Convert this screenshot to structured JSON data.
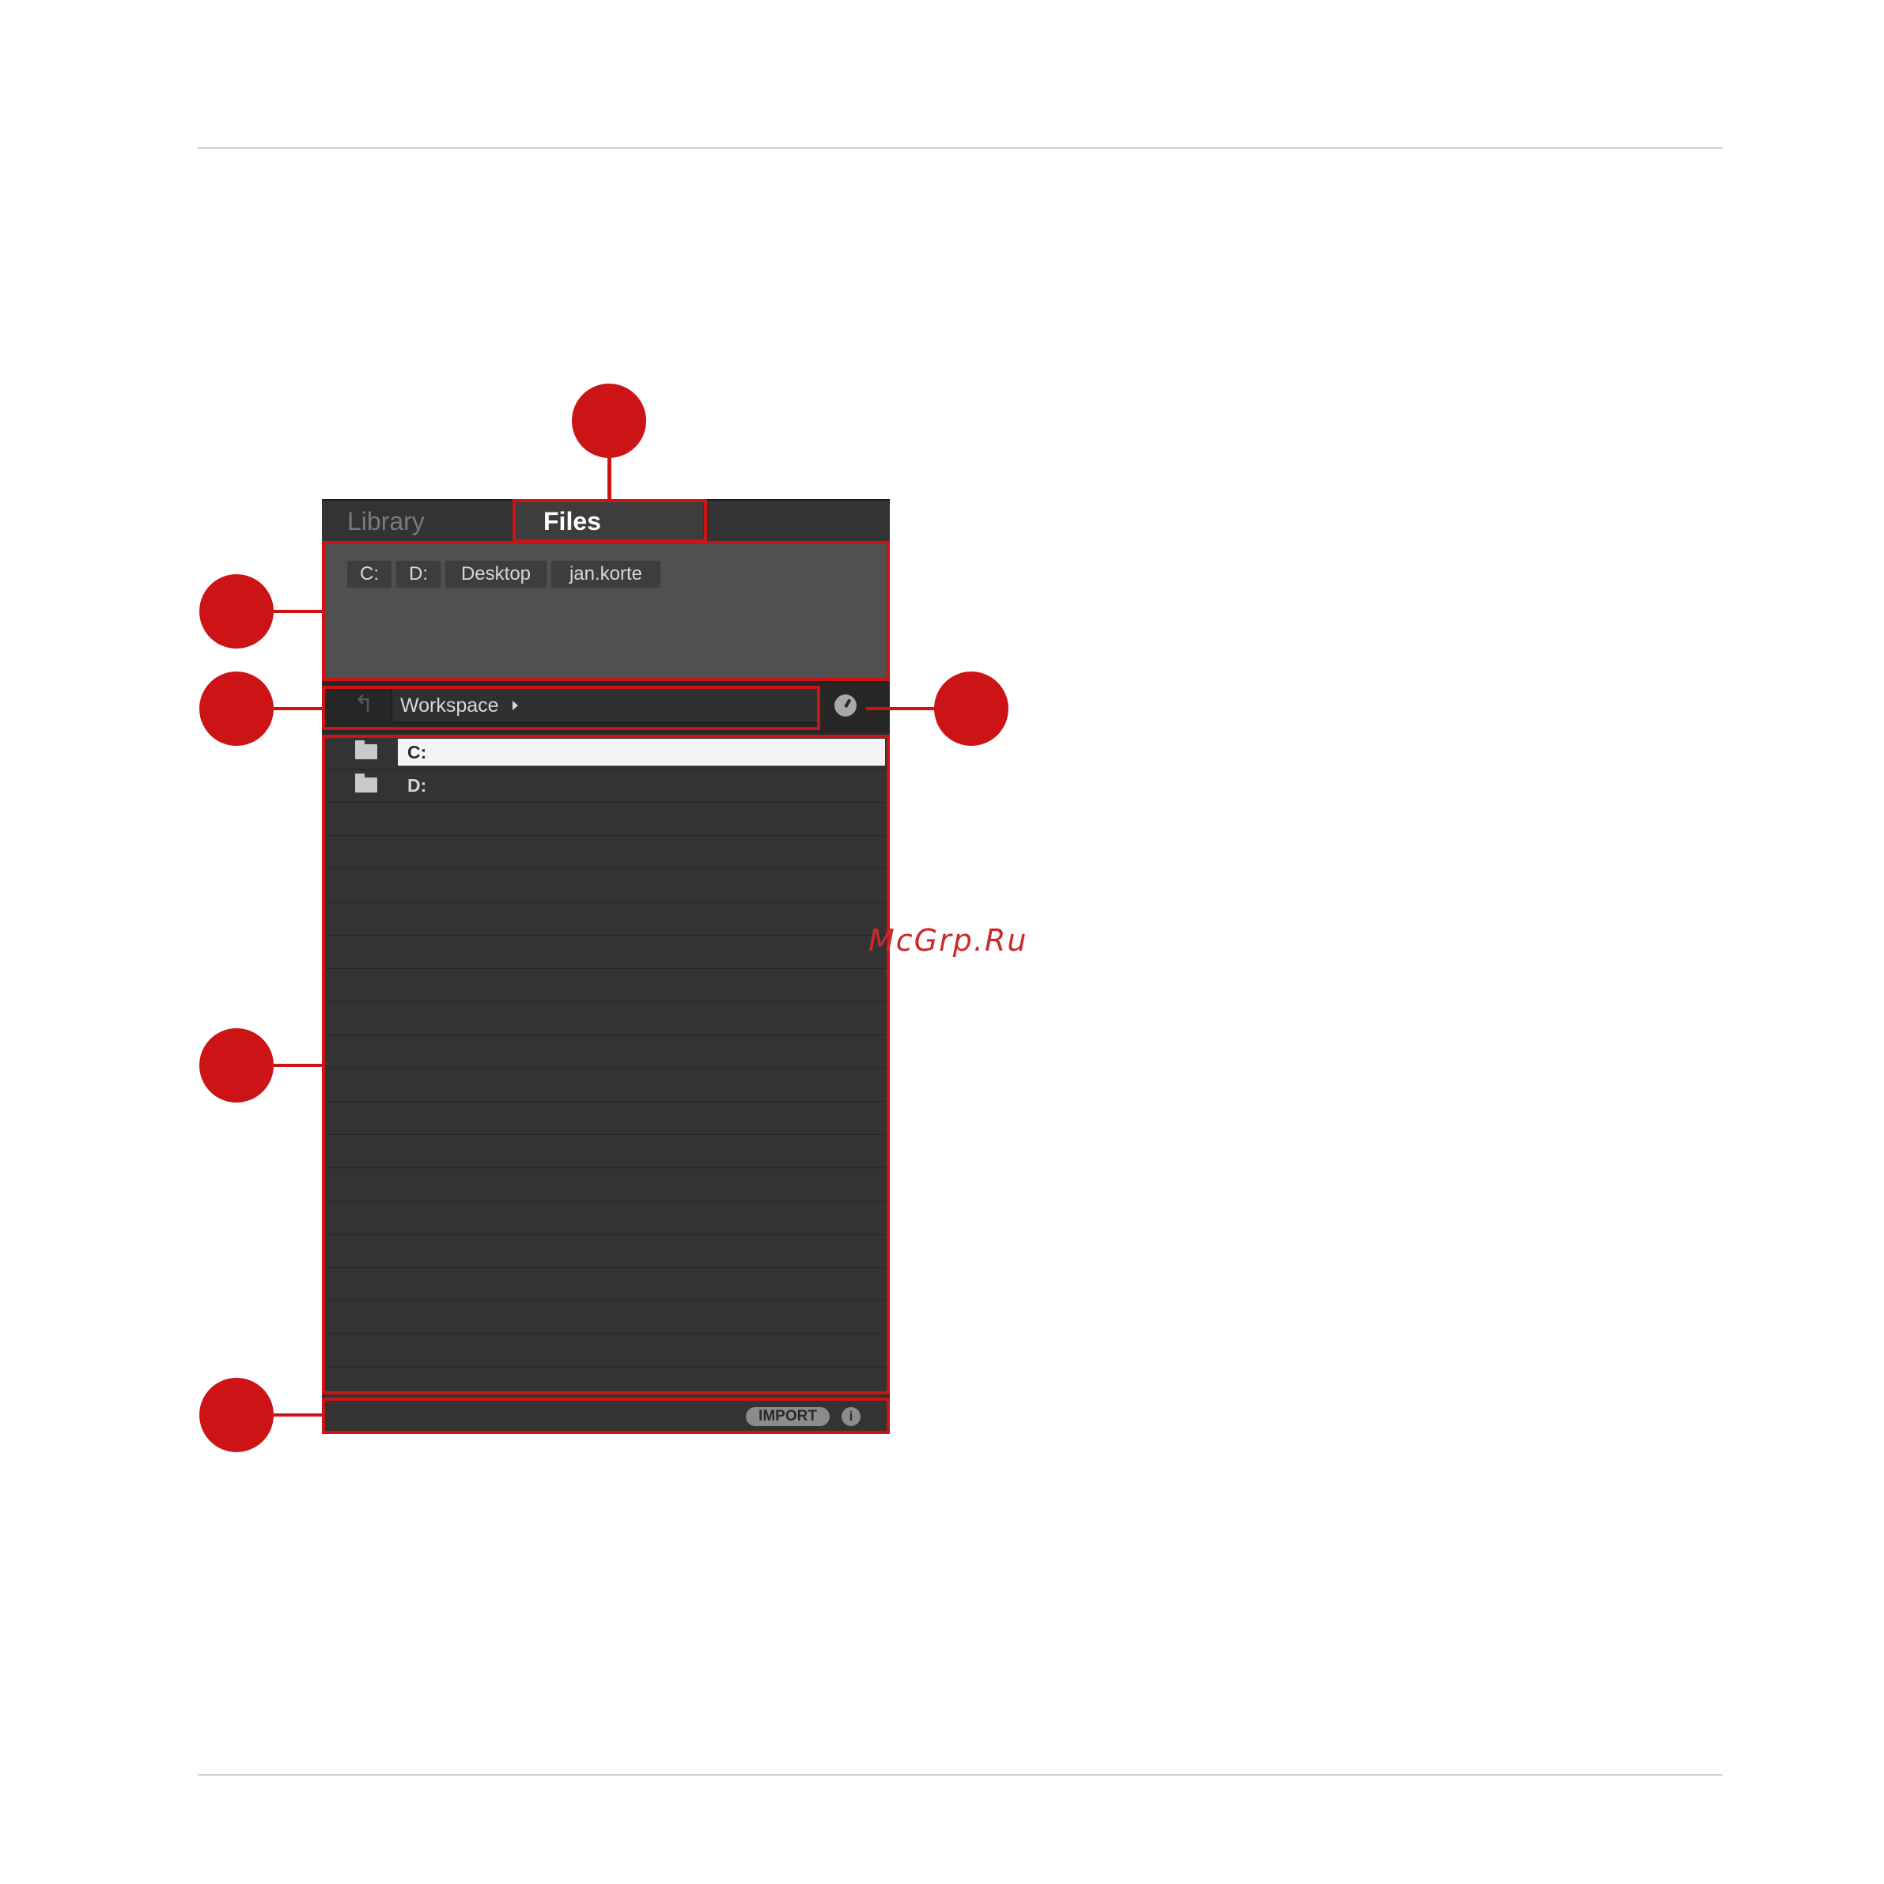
{
  "tabs": {
    "library": "Library",
    "files": "Files"
  },
  "favorites": [
    "C:",
    "D:",
    "Desktop",
    "jan.korte"
  ],
  "location_bar": {
    "path": "Workspace",
    "up_icon": "up-arrow-icon",
    "recent_icon": "clock-icon"
  },
  "file_list": {
    "items": [
      {
        "name": "C:",
        "icon": "folder-icon",
        "selected": true
      },
      {
        "name": "D:",
        "icon": "folder-icon",
        "selected": false
      }
    ],
    "empty_rows": 18
  },
  "footer": {
    "import_label": "IMPORT",
    "info_label": "i"
  },
  "watermark": "McGrp.Ru",
  "colors": {
    "callout": "#cc1417",
    "panel_bg": "#2b2b2b",
    "selected_row": "#f4f4f4"
  }
}
